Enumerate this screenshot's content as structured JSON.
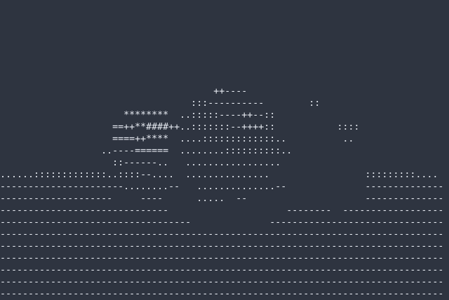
{
  "background_color": "#2e3440",
  "text_color": "#e5e9f0",
  "art_lines": [
    "                                      ++----                                    ",
    "                                  :::----------        ::                       ",
    "                      ********  ..:::::----++--::                               ",
    "                    ==++**####++..:::::::--++++::           ::::                ",
    "                    ====++****  ....:::::::::::::..          ..                 ",
    "                  ..----======  ........::::::::::..                            ",
    "                    ::------..   .................                              ",
    "......:::::::::::::..::::--....  ...............                 :::::::::.... ",
    "----------------------........--   ..............--              --------------",
    "--------------------     ----      .....  --                     --------------",
    "------------------------------                     --------  ------------------",
    "----------------------------------              -------------------------------",
    "-------------------------------------------------------------------------------",
    "-------------------------------------------------------------------------------",
    "-------------------------------------------------------------------------------",
    "-------------------------------------------------------------------------------",
    "-------------------------------------------------------------------------------",
    "-------------------------------------------------------------------------------"
  ]
}
